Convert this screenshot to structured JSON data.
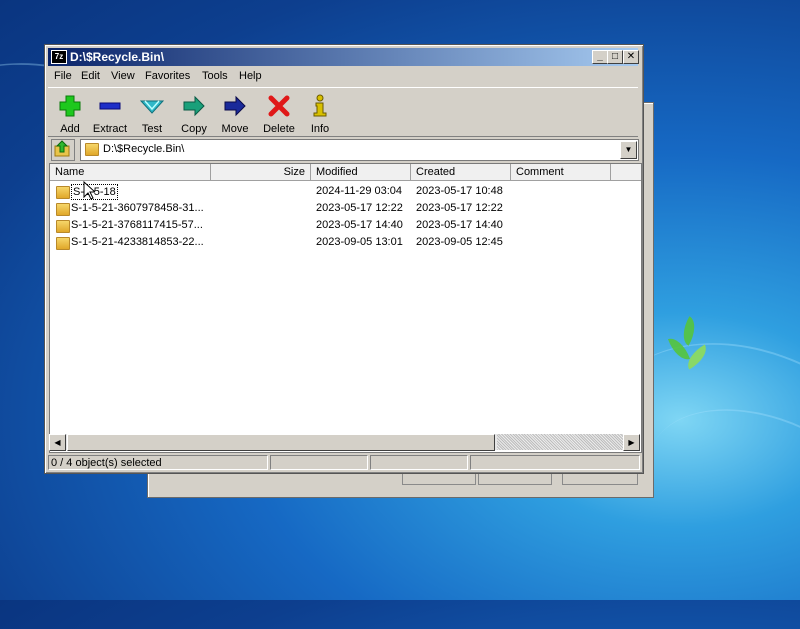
{
  "window": {
    "title": "D:\\$Recycle.Bin\\",
    "app_icon_text": "7z",
    "controls": {
      "minimize": "_",
      "maximize": "□",
      "close": "✕"
    }
  },
  "menu": [
    "File",
    "Edit",
    "View",
    "Favorites",
    "Tools",
    "Help"
  ],
  "toolbar": [
    {
      "label": "Add",
      "icon": "plus-icon",
      "color": "#1ec81e"
    },
    {
      "label": "Extract",
      "icon": "minus-icon",
      "color": "#1e2ec8"
    },
    {
      "label": "Test",
      "icon": "check-icon",
      "color": "#2fb8c8"
    },
    {
      "label": "Copy",
      "icon": "arrow-right-icon",
      "color": "#1aa07a"
    },
    {
      "label": "Move",
      "icon": "arrow-right-icon",
      "color": "#1a2a9a"
    },
    {
      "label": "Delete",
      "icon": "x-icon",
      "color": "#e01818"
    },
    {
      "label": "Info",
      "icon": "info-icon",
      "color": "#d8c000"
    }
  ],
  "address": {
    "path": "D:\\$Recycle.Bin\\"
  },
  "columns": [
    "Name",
    "Size",
    "Modified",
    "Created",
    "Comment"
  ],
  "files": [
    {
      "name": "S-1-5-18",
      "size": "",
      "modified": "2024-11-29 03:04",
      "created": "2023-05-17 10:48",
      "comment": ""
    },
    {
      "name": "S-1-5-21-3607978458-31...",
      "size": "",
      "modified": "2023-05-17 12:22",
      "created": "2023-05-17 12:22",
      "comment": ""
    },
    {
      "name": "S-1-5-21-3768117415-57...",
      "size": "",
      "modified": "2023-05-17 14:40",
      "created": "2023-05-17 14:40",
      "comment": ""
    },
    {
      "name": "S-1-5-21-4233814853-22...",
      "size": "",
      "modified": "2023-09-05 13:01",
      "created": "2023-09-05 12:45",
      "comment": ""
    }
  ],
  "status": {
    "selection": "0 / 4 object(s) selected",
    "panel2": "",
    "panel3": "",
    "panel4": ""
  }
}
